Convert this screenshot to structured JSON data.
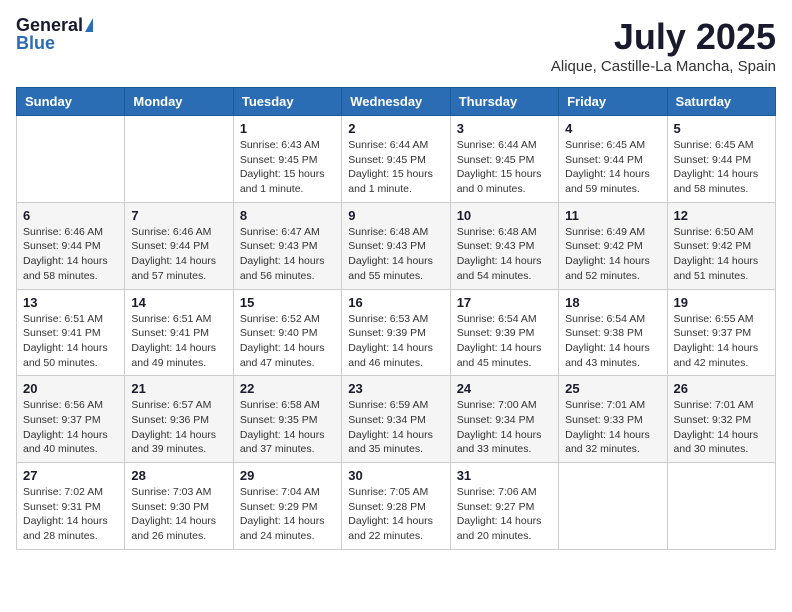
{
  "header": {
    "logo_general": "General",
    "logo_blue": "Blue",
    "main_title": "July 2025",
    "subtitle": "Alique, Castille-La Mancha, Spain"
  },
  "columns": [
    "Sunday",
    "Monday",
    "Tuesday",
    "Wednesday",
    "Thursday",
    "Friday",
    "Saturday"
  ],
  "weeks": [
    [
      {
        "day": "",
        "sunrise": "",
        "sunset": "",
        "daylight": ""
      },
      {
        "day": "",
        "sunrise": "",
        "sunset": "",
        "daylight": ""
      },
      {
        "day": "1",
        "sunrise": "Sunrise: 6:43 AM",
        "sunset": "Sunset: 9:45 PM",
        "daylight": "Daylight: 15 hours and 1 minute."
      },
      {
        "day": "2",
        "sunrise": "Sunrise: 6:44 AM",
        "sunset": "Sunset: 9:45 PM",
        "daylight": "Daylight: 15 hours and 1 minute."
      },
      {
        "day": "3",
        "sunrise": "Sunrise: 6:44 AM",
        "sunset": "Sunset: 9:45 PM",
        "daylight": "Daylight: 15 hours and 0 minutes."
      },
      {
        "day": "4",
        "sunrise": "Sunrise: 6:45 AM",
        "sunset": "Sunset: 9:44 PM",
        "daylight": "Daylight: 14 hours and 59 minutes."
      },
      {
        "day": "5",
        "sunrise": "Sunrise: 6:45 AM",
        "sunset": "Sunset: 9:44 PM",
        "daylight": "Daylight: 14 hours and 58 minutes."
      }
    ],
    [
      {
        "day": "6",
        "sunrise": "Sunrise: 6:46 AM",
        "sunset": "Sunset: 9:44 PM",
        "daylight": "Daylight: 14 hours and 58 minutes."
      },
      {
        "day": "7",
        "sunrise": "Sunrise: 6:46 AM",
        "sunset": "Sunset: 9:44 PM",
        "daylight": "Daylight: 14 hours and 57 minutes."
      },
      {
        "day": "8",
        "sunrise": "Sunrise: 6:47 AM",
        "sunset": "Sunset: 9:43 PM",
        "daylight": "Daylight: 14 hours and 56 minutes."
      },
      {
        "day": "9",
        "sunrise": "Sunrise: 6:48 AM",
        "sunset": "Sunset: 9:43 PM",
        "daylight": "Daylight: 14 hours and 55 minutes."
      },
      {
        "day": "10",
        "sunrise": "Sunrise: 6:48 AM",
        "sunset": "Sunset: 9:43 PM",
        "daylight": "Daylight: 14 hours and 54 minutes."
      },
      {
        "day": "11",
        "sunrise": "Sunrise: 6:49 AM",
        "sunset": "Sunset: 9:42 PM",
        "daylight": "Daylight: 14 hours and 52 minutes."
      },
      {
        "day": "12",
        "sunrise": "Sunrise: 6:50 AM",
        "sunset": "Sunset: 9:42 PM",
        "daylight": "Daylight: 14 hours and 51 minutes."
      }
    ],
    [
      {
        "day": "13",
        "sunrise": "Sunrise: 6:51 AM",
        "sunset": "Sunset: 9:41 PM",
        "daylight": "Daylight: 14 hours and 50 minutes."
      },
      {
        "day": "14",
        "sunrise": "Sunrise: 6:51 AM",
        "sunset": "Sunset: 9:41 PM",
        "daylight": "Daylight: 14 hours and 49 minutes."
      },
      {
        "day": "15",
        "sunrise": "Sunrise: 6:52 AM",
        "sunset": "Sunset: 9:40 PM",
        "daylight": "Daylight: 14 hours and 47 minutes."
      },
      {
        "day": "16",
        "sunrise": "Sunrise: 6:53 AM",
        "sunset": "Sunset: 9:39 PM",
        "daylight": "Daylight: 14 hours and 46 minutes."
      },
      {
        "day": "17",
        "sunrise": "Sunrise: 6:54 AM",
        "sunset": "Sunset: 9:39 PM",
        "daylight": "Daylight: 14 hours and 45 minutes."
      },
      {
        "day": "18",
        "sunrise": "Sunrise: 6:54 AM",
        "sunset": "Sunset: 9:38 PM",
        "daylight": "Daylight: 14 hours and 43 minutes."
      },
      {
        "day": "19",
        "sunrise": "Sunrise: 6:55 AM",
        "sunset": "Sunset: 9:37 PM",
        "daylight": "Daylight: 14 hours and 42 minutes."
      }
    ],
    [
      {
        "day": "20",
        "sunrise": "Sunrise: 6:56 AM",
        "sunset": "Sunset: 9:37 PM",
        "daylight": "Daylight: 14 hours and 40 minutes."
      },
      {
        "day": "21",
        "sunrise": "Sunrise: 6:57 AM",
        "sunset": "Sunset: 9:36 PM",
        "daylight": "Daylight: 14 hours and 39 minutes."
      },
      {
        "day": "22",
        "sunrise": "Sunrise: 6:58 AM",
        "sunset": "Sunset: 9:35 PM",
        "daylight": "Daylight: 14 hours and 37 minutes."
      },
      {
        "day": "23",
        "sunrise": "Sunrise: 6:59 AM",
        "sunset": "Sunset: 9:34 PM",
        "daylight": "Daylight: 14 hours and 35 minutes."
      },
      {
        "day": "24",
        "sunrise": "Sunrise: 7:00 AM",
        "sunset": "Sunset: 9:34 PM",
        "daylight": "Daylight: 14 hours and 33 minutes."
      },
      {
        "day": "25",
        "sunrise": "Sunrise: 7:01 AM",
        "sunset": "Sunset: 9:33 PM",
        "daylight": "Daylight: 14 hours and 32 minutes."
      },
      {
        "day": "26",
        "sunrise": "Sunrise: 7:01 AM",
        "sunset": "Sunset: 9:32 PM",
        "daylight": "Daylight: 14 hours and 30 minutes."
      }
    ],
    [
      {
        "day": "27",
        "sunrise": "Sunrise: 7:02 AM",
        "sunset": "Sunset: 9:31 PM",
        "daylight": "Daylight: 14 hours and 28 minutes."
      },
      {
        "day": "28",
        "sunrise": "Sunrise: 7:03 AM",
        "sunset": "Sunset: 9:30 PM",
        "daylight": "Daylight: 14 hours and 26 minutes."
      },
      {
        "day": "29",
        "sunrise": "Sunrise: 7:04 AM",
        "sunset": "Sunset: 9:29 PM",
        "daylight": "Daylight: 14 hours and 24 minutes."
      },
      {
        "day": "30",
        "sunrise": "Sunrise: 7:05 AM",
        "sunset": "Sunset: 9:28 PM",
        "daylight": "Daylight: 14 hours and 22 minutes."
      },
      {
        "day": "31",
        "sunrise": "Sunrise: 7:06 AM",
        "sunset": "Sunset: 9:27 PM",
        "daylight": "Daylight: 14 hours and 20 minutes."
      },
      {
        "day": "",
        "sunrise": "",
        "sunset": "",
        "daylight": ""
      },
      {
        "day": "",
        "sunrise": "",
        "sunset": "",
        "daylight": ""
      }
    ]
  ]
}
